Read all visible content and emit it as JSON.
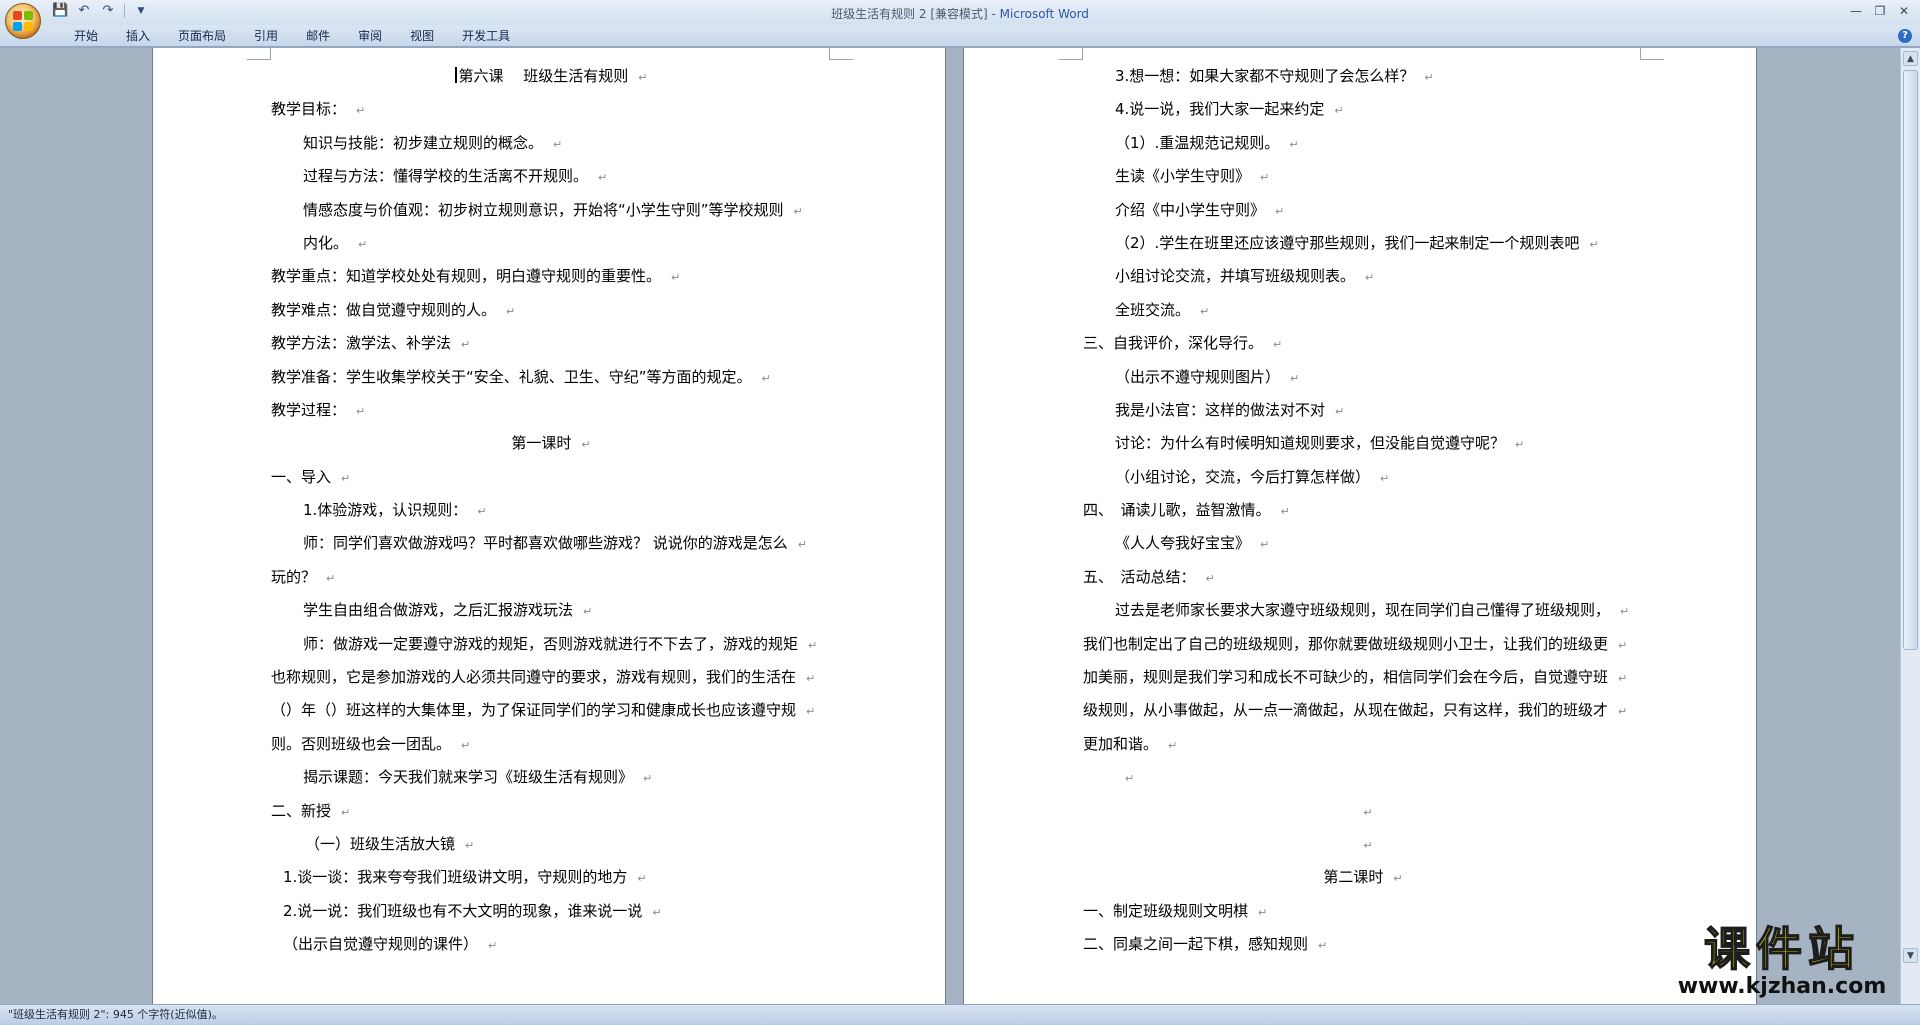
{
  "window": {
    "title_doc": "班级生活有规则 2 [兼容模式] - ",
    "title_app": "Microsoft Word"
  },
  "qat": {
    "save_icon": "save-icon",
    "undo_icon": "undo-icon",
    "redo_icon": "redo-icon"
  },
  "ribbon": {
    "tabs": [
      "开始",
      "插入",
      "页面布局",
      "引用",
      "邮件",
      "审阅",
      "视图",
      "开发工具"
    ]
  },
  "document": {
    "left_page": [
      {
        "text": "第六课　 班级生活有规则",
        "align": "center",
        "cursor": true
      },
      {
        "text": "教学目标：",
        "indent": 0
      },
      {
        "text": "知识与技能：初步建立规则的概念。",
        "indent": 1
      },
      {
        "text": "过程与方法：懂得学校的生活离不开规则。",
        "indent": 1
      },
      {
        "text": "情感态度与价值观：初步树立规则意识，开始将“小学生守则”等学校规则",
        "indent": 1
      },
      {
        "text": "内化。",
        "indent": 1
      },
      {
        "text": "教学重点：知道学校处处有规则，明白遵守规则的重要性。",
        "indent": 0
      },
      {
        "text": "教学难点：做自觉遵守规则的人。",
        "indent": 0
      },
      {
        "text": "教学方法：激学法、补学法",
        "indent": 0
      },
      {
        "text": "教学准备：学生收集学校关于“安全、礼貌、卫生、守纪”等方面的规定。",
        "indent": 0
      },
      {
        "text": "教学过程：",
        "indent": 0
      },
      {
        "text": "第一课时",
        "align": "center"
      },
      {
        "text": "一、导入",
        "indent": 0
      },
      {
        "text": "1.体验游戏，认识规则：",
        "indent": 1
      },
      {
        "text": "师：同学们喜欢做游戏吗？平时都喜欢做哪些游戏？ 说说你的游戏是怎么",
        "indent": 1
      },
      {
        "text": "玩的？",
        "indent": 0
      },
      {
        "text": "学生自由组合做游戏，之后汇报游戏玩法",
        "indent": 1
      },
      {
        "text": "师：做游戏一定要遵守游戏的规矩，否则游戏就进行不下去了，游戏的规矩",
        "indent": 1
      },
      {
        "text": "也称规则，它是参加游戏的人必须共同遵守的要求，游戏有规则，我们的生活在",
        "indent": 0
      },
      {
        "text": "（）年（）班这样的大集体里，为了保证同学们的学习和健康成长也应该遵守规",
        "indent": 0
      },
      {
        "text": "则。否则班级也会一团乱。",
        "indent": 0
      },
      {
        "text": "揭示课题：今天我们就来学习《班级生活有规则》",
        "indent": 1
      },
      {
        "text": "二、新授",
        "indent": 0
      },
      {
        "text": "（一）班级生活放大镜",
        "indent": 3
      },
      {
        "text": "1.谈一谈：我来夸夸我们班级讲文明，守规则的地方",
        "indent": 2
      },
      {
        "text": "2.说一说：我们班级也有不大文明的现象，谁来说一说",
        "indent": 2
      },
      {
        "text": "（出示自觉遵守规则的课件）",
        "indent": 2
      }
    ],
    "right_page": [
      {
        "text": "3.想一想：如果大家都不守规则了会怎么样？",
        "indent": 1
      },
      {
        "text": "4.说一说，我们大家一起来约定",
        "indent": 1
      },
      {
        "text": "（1）.重温规范记规则。",
        "indent": 1
      },
      {
        "text": "生读《小学生守则》",
        "indent": 1
      },
      {
        "text": "介绍《中小学生守则》",
        "indent": 1
      },
      {
        "text": "（2）.学生在班里还应该遵守那些规则，我们一起来制定一个规则表吧",
        "indent": 1
      },
      {
        "text": "小组讨论交流，并填写班级规则表。",
        "indent": 1
      },
      {
        "text": "全班交流。",
        "indent": 1
      },
      {
        "text": "三、自我评价，深化导行。",
        "indent": 0
      },
      {
        "text": "（出示不遵守规则图片）",
        "indent": 1
      },
      {
        "text": "我是小法官：这样的做法对不对",
        "indent": 1
      },
      {
        "text": "讨论：为什么有时候明知道规则要求，但没能自觉遵守呢？",
        "indent": 1
      },
      {
        "text": "（小组讨论，交流，今后打算怎样做）",
        "indent": 1
      },
      {
        "text": "四、　诵读儿歌，益智激情。",
        "indent": 0
      },
      {
        "text": "《人人夸我好宝宝》",
        "indent": 1
      },
      {
        "text": "五、　活动总结：",
        "indent": 0
      },
      {
        "text": "过去是老师家长要求大家遵守班级规则，现在同学们自己懂得了班级规则，",
        "indent": 1
      },
      {
        "text": "我们也制定出了自己的班级规则，那你就要做班级规则小卫士，让我们的班级更",
        "indent": 0
      },
      {
        "text": "加美丽，规则是我们学习和成长不可缺少的，相信同学们会在今后，自觉遵守班",
        "indent": 0
      },
      {
        "text": "级规则，从小事做起，从一点一滴做起，从现在做起，只有这样，我们的班级才",
        "indent": 0
      },
      {
        "text": "更加和谐。",
        "indent": 0
      },
      {
        "text": "",
        "indent": 1
      },
      {
        "text": "",
        "align": "center"
      },
      {
        "text": "",
        "align": "center"
      },
      {
        "text": "第二课时",
        "align": "center"
      },
      {
        "text": "一、制定班级规则文明棋",
        "indent": 0
      },
      {
        "text": "二、同桌之间一起下棋，感知规则",
        "indent": 0
      }
    ]
  },
  "statusbar": {
    "text": "\"班级生活有规则 2\": 945 个字符(近似值)。"
  },
  "watermark": {
    "title": "课件站",
    "url": "www.kjzhan.com"
  },
  "colors": {
    "accent": "#2b57a6",
    "workspace": "#a5b3c2",
    "watermark_yellow": "#f4e300"
  }
}
